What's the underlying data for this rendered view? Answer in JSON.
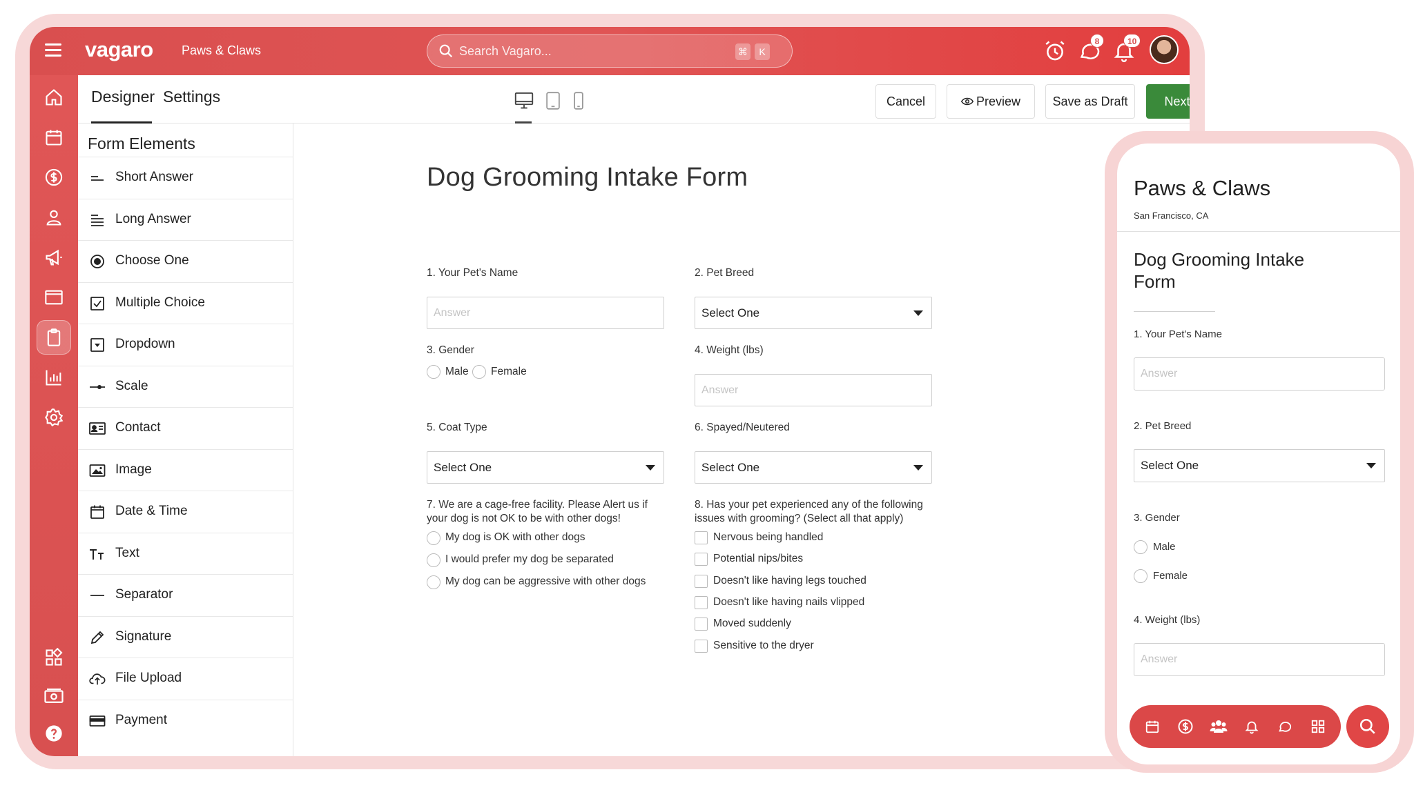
{
  "topbar": {
    "logo": "vagaro",
    "business_name": "Paws & Claws",
    "search_placeholder": "Search Vagaro...",
    "shortcut_mod": "⌘",
    "shortcut_key": "K",
    "messages_badge": "8",
    "notifications_badge": "10"
  },
  "toolbar": {
    "tabs": [
      "Designer",
      "Settings"
    ],
    "active_tab": "Designer",
    "devices": [
      "desktop-icon",
      "tablet-icon",
      "phone-icon"
    ],
    "active_device": "desktop",
    "cancel_label": "Cancel",
    "preview_label": "Preview",
    "save_draft_label": "Save as Draft",
    "next_label": "Next"
  },
  "sidebar": {
    "icons": [
      "home-icon",
      "calendar-icon",
      "dollar-icon",
      "user-icon",
      "megaphone-icon",
      "browser-icon",
      "clipboard-icon",
      "chart-icon",
      "gear-icon",
      "apps-icon",
      "cash-icon",
      "help-icon"
    ],
    "active": "clipboard-icon"
  },
  "elements_panel": {
    "title": "Form Elements",
    "items": [
      {
        "label": "Short Answer",
        "icon": "short-answer-icon"
      },
      {
        "label": "Long Answer",
        "icon": "long-answer-icon"
      },
      {
        "label": "Choose One",
        "icon": "radio-icon"
      },
      {
        "label": "Multiple Choice",
        "icon": "checkbox-icon"
      },
      {
        "label": "Dropdown",
        "icon": "dropdown-icon"
      },
      {
        "label": "Scale",
        "icon": "scale-icon"
      },
      {
        "label": "Contact",
        "icon": "contact-card-icon"
      },
      {
        "label": "Image",
        "icon": "image-icon"
      },
      {
        "label": "Date & Time",
        "icon": "calendar-icon"
      },
      {
        "label": "Text",
        "icon": "text-icon"
      },
      {
        "label": "Separator",
        "icon": "separator-icon"
      },
      {
        "label": "Signature",
        "icon": "pen-icon"
      },
      {
        "label": "File Upload",
        "icon": "cloud-upload-icon"
      },
      {
        "label": "Payment",
        "icon": "credit-card-icon"
      }
    ]
  },
  "form": {
    "title": "Dog Grooming Intake Form",
    "q1": {
      "label": "1. Your Pet's Name",
      "placeholder": "Answer"
    },
    "q2": {
      "label": "2. Pet Breed",
      "value": "Select One"
    },
    "q3": {
      "label": "3. Gender",
      "options": [
        "Male",
        "Female"
      ]
    },
    "q4": {
      "label": "4. Weight (lbs)",
      "placeholder": "Answer"
    },
    "q5": {
      "label": "5. Coat Type",
      "value": "Select One"
    },
    "q6": {
      "label": "6. Spayed/Neutered",
      "value": "Select One"
    },
    "q7": {
      "label": "7. We are a cage-free facility. Please Alert us if your dog is not OK to be with other dogs!",
      "options": [
        "My dog is OK with other dogs",
        "I would prefer my dog be separated",
        "My dog can be aggressive with other dogs"
      ]
    },
    "q8": {
      "label": "8. Has your pet experienced any of the following issues with grooming? (Select all that apply)",
      "options": [
        "Nervous being handled",
        "Potential nips/bites",
        "Doesn't like having legs touched",
        "Doesn't like having nails vlipped",
        "Moved suddenly",
        "Sensitive to the dryer"
      ]
    }
  },
  "phone": {
    "business_name": "Paws & Claws",
    "location": "San Francisco, CA",
    "form_title": "Dog Grooming Intake Form",
    "q1_label": "1. Your Pet's Name",
    "q1_placeholder": "Answer",
    "q2_label": "2. Pet Breed",
    "q2_value": "Select One",
    "q3_label": "3. Gender",
    "q3_options": [
      "Male",
      "Female"
    ],
    "q4_label": "4. Weight (lbs)",
    "q4_placeholder": "Answer",
    "bottom_nav": [
      "calendar-icon",
      "dollar-icon",
      "group-icon",
      "bell-icon",
      "chat-icon",
      "apps-icon"
    ],
    "fab": "search-icon"
  },
  "colors": {
    "brand_red": "#d94f4f",
    "primary_green": "#3a8a3a",
    "halo_pink": "#f7d8d8"
  }
}
